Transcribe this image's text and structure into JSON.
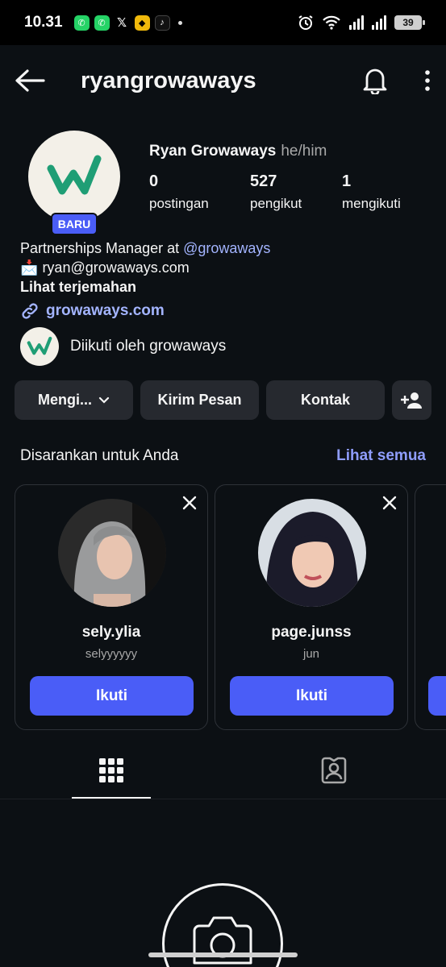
{
  "status": {
    "time": "10.31",
    "battery": "39",
    "app_icons": [
      "whatsapp-icon",
      "whatsapp-business-icon",
      "x-icon",
      "binance-icon",
      "tiktok-icon"
    ]
  },
  "header": {
    "username": "ryangrowaways"
  },
  "profile": {
    "display_name": "Ryan Growaways",
    "pronouns": "he/him",
    "badge": "BARU",
    "stats": [
      {
        "count": "0",
        "label": "postingan"
      },
      {
        "count": "527",
        "label": "pengikut"
      },
      {
        "count": "1",
        "label": "mengikuti"
      }
    ],
    "bio_prefix": "Partnerships Manager at ",
    "bio_mention": "@growaways",
    "bio_email": "ryan@growaways.com",
    "translate": "Lihat terjemahan",
    "link": "growaways.com",
    "followed_by": "Diikuti oleh growaways"
  },
  "actions": {
    "following": "Mengi...",
    "message": "Kirim Pesan",
    "contact": "Kontak"
  },
  "suggestions": {
    "title": "Disarankan untuk Anda",
    "see_all": "Lihat semua",
    "cards": [
      {
        "username": "sely.ylia",
        "subtitle": "selyyyyyy",
        "follow": "Ikuti"
      },
      {
        "username": "page.junss",
        "subtitle": "jun",
        "follow": "Ikuti"
      }
    ]
  },
  "colors": {
    "background": "#0c1014",
    "accent": "#4a5df7",
    "link": "#a3b4ff",
    "brand_green": "#1f9e75"
  }
}
